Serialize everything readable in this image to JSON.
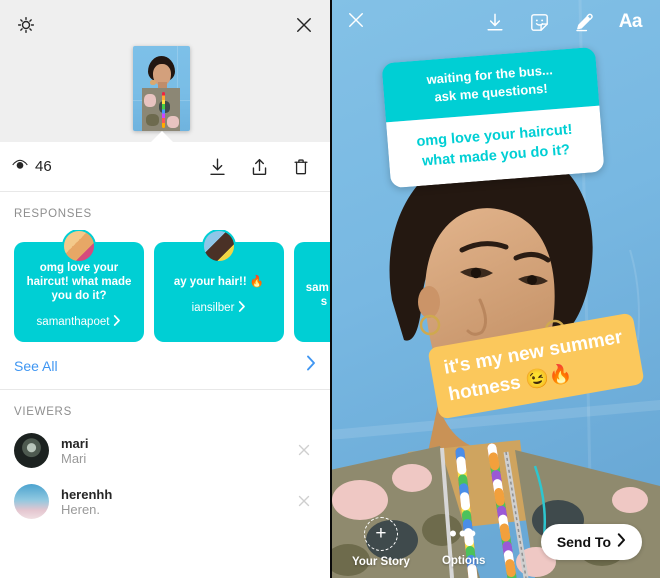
{
  "left_panel": {
    "top_bar": {
      "settings_icon": "gear-icon",
      "close_icon": "close-icon"
    },
    "stats": {
      "views_icon": "eye-icon",
      "views_count": "46",
      "download_icon": "download-icon",
      "share_icon": "share-icon",
      "delete_icon": "trash-icon"
    },
    "responses": {
      "section_title": "RESPONSES",
      "cards": [
        {
          "text": "omg love your haircut! what made you do it?",
          "username": "samanthapoet",
          "chevron": "chevron-right-icon"
        },
        {
          "text": "ay your hair!! 🔥",
          "username": "iansilber",
          "chevron": "chevron-right-icon"
        },
        {
          "text": "sam te s",
          "username": "",
          "chevron": "chevron-right-icon"
        }
      ],
      "see_all_label": "See All",
      "see_all_chevron": "chevron-right-icon"
    },
    "viewers": {
      "section_title": "VIEWERS",
      "rows": [
        {
          "username": "mari",
          "fullname": "Mari",
          "remove_icon": "close-icon"
        },
        {
          "username": "herenhh",
          "fullname": "Heren.",
          "remove_icon": "close-icon"
        }
      ]
    }
  },
  "right_panel": {
    "top_bar": {
      "close_icon": "close-icon",
      "save_icon": "download-icon",
      "sticker_icon": "sticker-smiley-icon",
      "draw_icon": "marker-pen-icon",
      "text_label": "Aa"
    },
    "question_sticker": {
      "prompt_line1": "waiting for the bus...",
      "prompt_line2": "ask me questions!",
      "answer": "omg love your haircut! what made you do it?"
    },
    "text_sticker": {
      "text": "it's my new summer hotness 😉🔥"
    },
    "bottom_bar": {
      "your_story_label": "Your Story",
      "your_story_icon": "plus-circle-icon",
      "options_label": "Options",
      "options_icon": "ellipsis-icon",
      "send_to_label": "Send To",
      "send_to_chevron": "chevron-right-icon"
    }
  },
  "colors": {
    "teal": "#00cfd4",
    "amber": "#fbc85c",
    "link_blue": "#3f96f2",
    "panel_grey": "#efefef",
    "photo_blue": "#6fb3de"
  }
}
